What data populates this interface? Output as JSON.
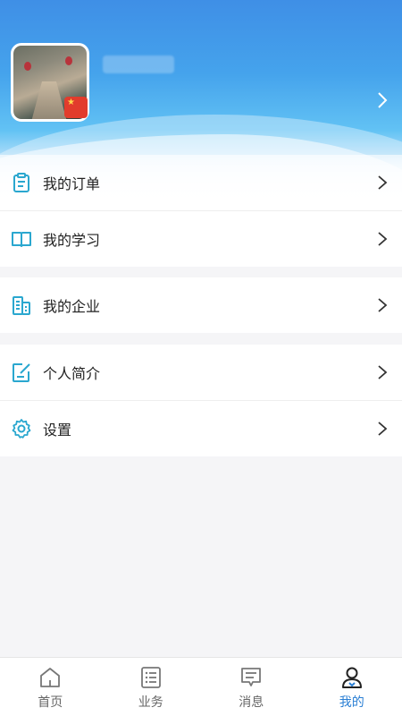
{
  "colors": {
    "accent": "#2a7fd4",
    "icon_cyan": "#2aa7cf",
    "header_top": "#3f8fe6",
    "header_mid": "#62c2f4",
    "background": "#f5f5f7"
  },
  "profile": {
    "flag_icon": "china-flag"
  },
  "menu_groups": [
    [
      {
        "label": "我的订单",
        "icon": "clipboard-icon"
      },
      {
        "label": "我的学习",
        "icon": "book-icon"
      }
    ],
    [
      {
        "label": "我的企业",
        "icon": "building-icon"
      }
    ],
    [
      {
        "label": "个人简介",
        "icon": "edit-note-icon"
      },
      {
        "label": "设置",
        "icon": "gear-icon"
      }
    ]
  ],
  "tabbar": {
    "tabs": [
      {
        "label": "首页",
        "icon": "home-icon"
      },
      {
        "label": "业务",
        "icon": "list-icon"
      },
      {
        "label": "消息",
        "icon": "message-icon"
      },
      {
        "label": "我的",
        "icon": "user-icon"
      }
    ],
    "active": "我的"
  }
}
